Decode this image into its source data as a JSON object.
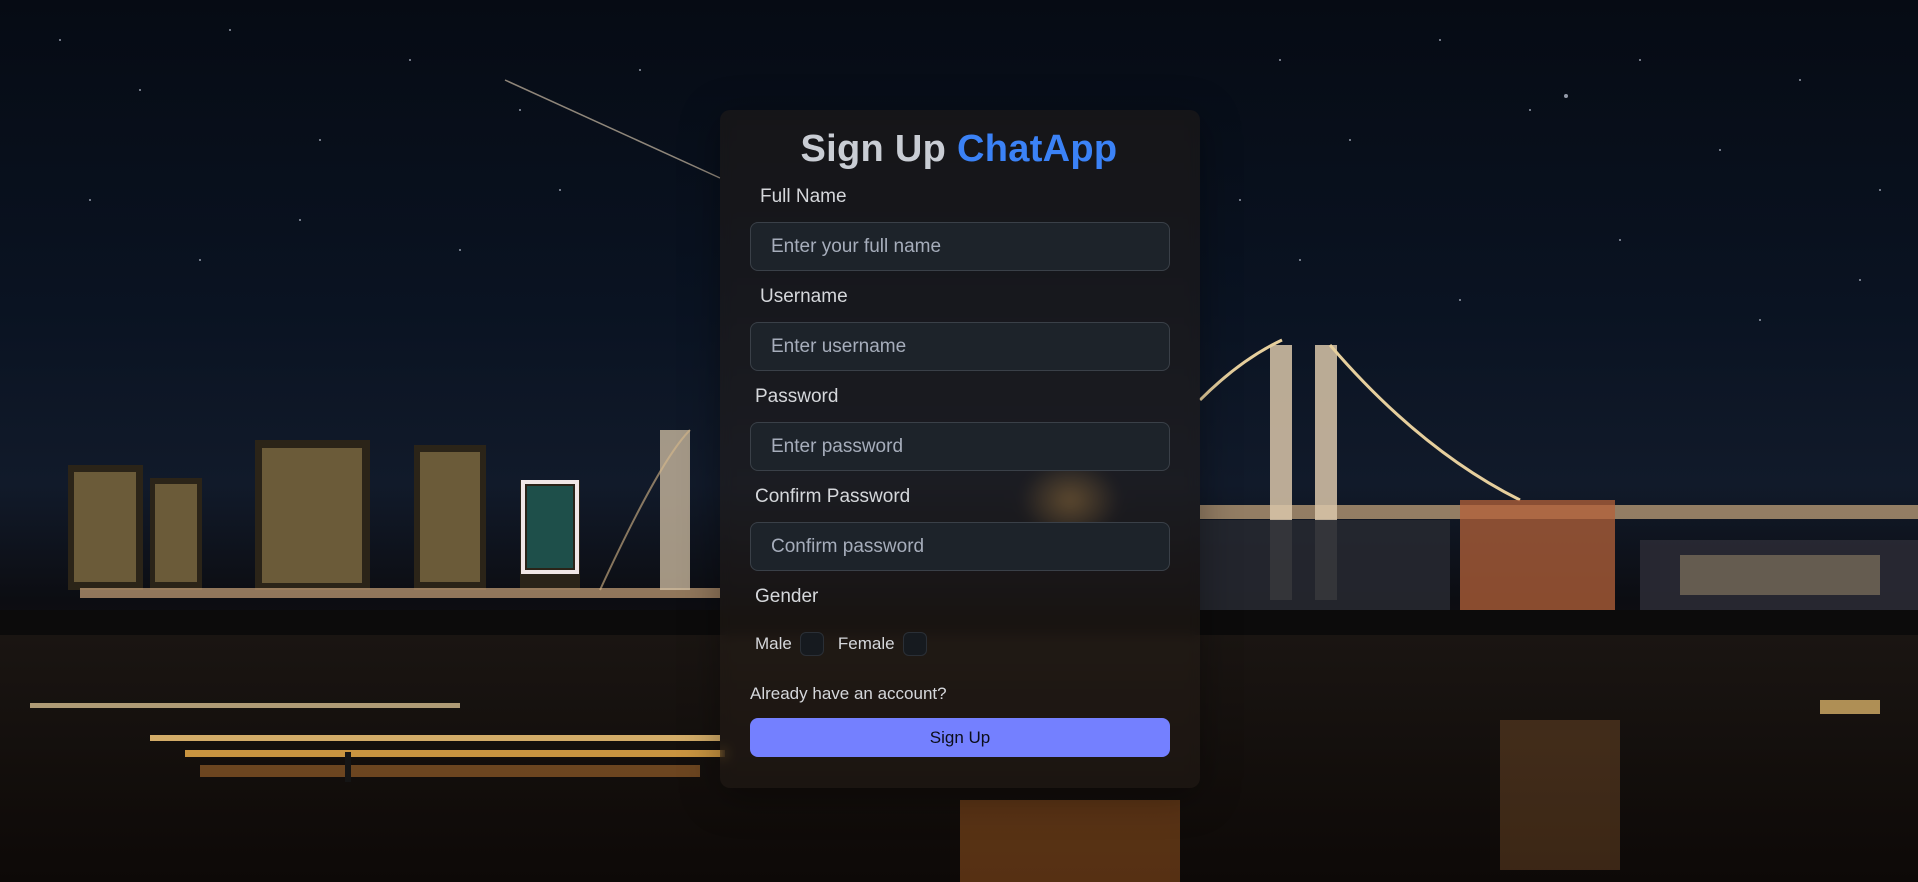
{
  "app": {
    "title_prefix": "Sign Up",
    "title_brand": "ChatApp",
    "brand_color": "#3b82f6"
  },
  "form": {
    "full_name": {
      "label": "Full Name",
      "placeholder": "Enter your full name",
      "value": ""
    },
    "username": {
      "label": "Username",
      "placeholder": "Enter username",
      "value": ""
    },
    "password": {
      "label": "Password",
      "placeholder": "Enter password",
      "value": ""
    },
    "confirm_password": {
      "label": "Confirm Password",
      "placeholder": "Confirm password",
      "value": ""
    },
    "gender": {
      "label": "Gender",
      "options": [
        {
          "label": "Male",
          "checked": false
        },
        {
          "label": "Female",
          "checked": false
        }
      ]
    },
    "login_link": "Already have an account?",
    "submit_label": "Sign Up",
    "button_color": "#7480ff"
  },
  "background": {
    "description_icon": "night-city-bridge-image"
  }
}
